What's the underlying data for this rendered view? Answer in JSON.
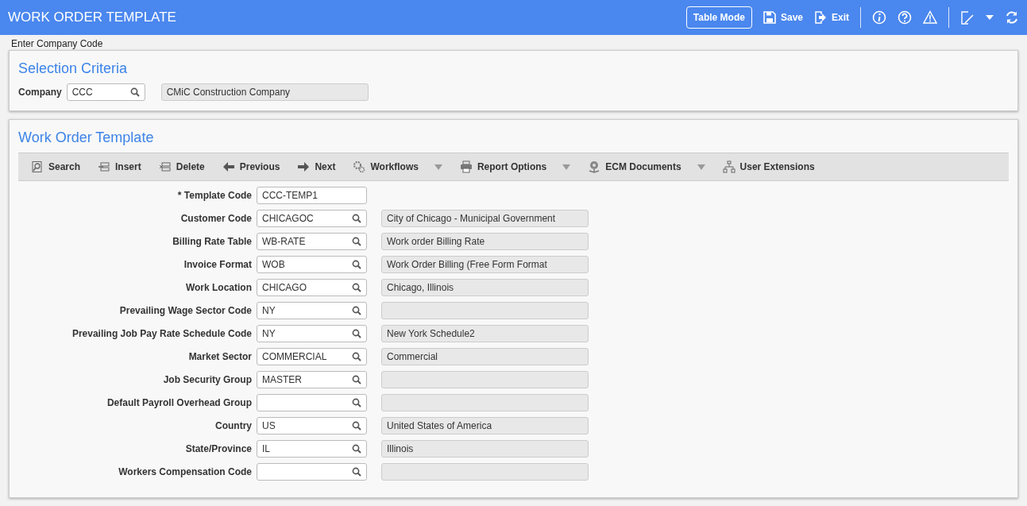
{
  "header": {
    "title": "WORK ORDER TEMPLATE",
    "table_mode": "Table Mode",
    "save": "Save",
    "exit": "Exit"
  },
  "hint": "Enter Company Code",
  "selection": {
    "title": "Selection Criteria",
    "label": "Company",
    "value": "CCC",
    "description": "CMiC Construction Company"
  },
  "form": {
    "title": "Work Order Template",
    "toolbar": [
      {
        "label": "Search",
        "has_menu": false
      },
      {
        "label": "Insert",
        "has_menu": false
      },
      {
        "label": "Delete",
        "has_menu": false
      },
      {
        "label": "Previous",
        "has_menu": false
      },
      {
        "label": "Next",
        "has_menu": false
      },
      {
        "label": "Workflows",
        "has_menu": true
      },
      {
        "label": "Report Options",
        "has_menu": true
      },
      {
        "label": "ECM Documents",
        "has_menu": true
      },
      {
        "label": "User Extensions",
        "has_menu": false
      }
    ],
    "fields": [
      {
        "label": "* Template Code",
        "value": "CCC-TEMP1",
        "kind": "plain"
      },
      {
        "label": "Customer Code",
        "value": "CHICAGOC",
        "kind": "lookup",
        "description": "City of Chicago - Municipal Government"
      },
      {
        "label": "Billing Rate Table",
        "value": "WB-RATE",
        "kind": "lookup",
        "description": "Work order Billing Rate"
      },
      {
        "label": "Invoice Format",
        "value": "WOB",
        "kind": "lookup",
        "description": "Work Order Billing (Free Form Format"
      },
      {
        "label": "Work Location",
        "value": "CHICAGO",
        "kind": "lookup",
        "description": "Chicago, Illinois"
      },
      {
        "label": "Prevailing Wage Sector Code",
        "value": "NY",
        "kind": "lookup"
      },
      {
        "label": "Prevailing Job Pay Rate Schedule Code",
        "value": "NY",
        "kind": "lookup",
        "description": "New York Schedule2"
      },
      {
        "label": "Market Sector",
        "value": "COMMERCIAL",
        "kind": "lookup",
        "description": "Commercial"
      },
      {
        "label": "Job Security Group",
        "value": "MASTER",
        "kind": "lookup"
      },
      {
        "label": "Default Payroll Overhead Group",
        "kind": "lookup"
      },
      {
        "label": "Country",
        "value": "US",
        "kind": "lookup",
        "description": "United States of America"
      },
      {
        "label": "State/Province",
        "value": "IL",
        "kind": "lookup",
        "description": "Illinois"
      },
      {
        "label": "Workers Compensation Code",
        "kind": "lookup"
      }
    ]
  }
}
